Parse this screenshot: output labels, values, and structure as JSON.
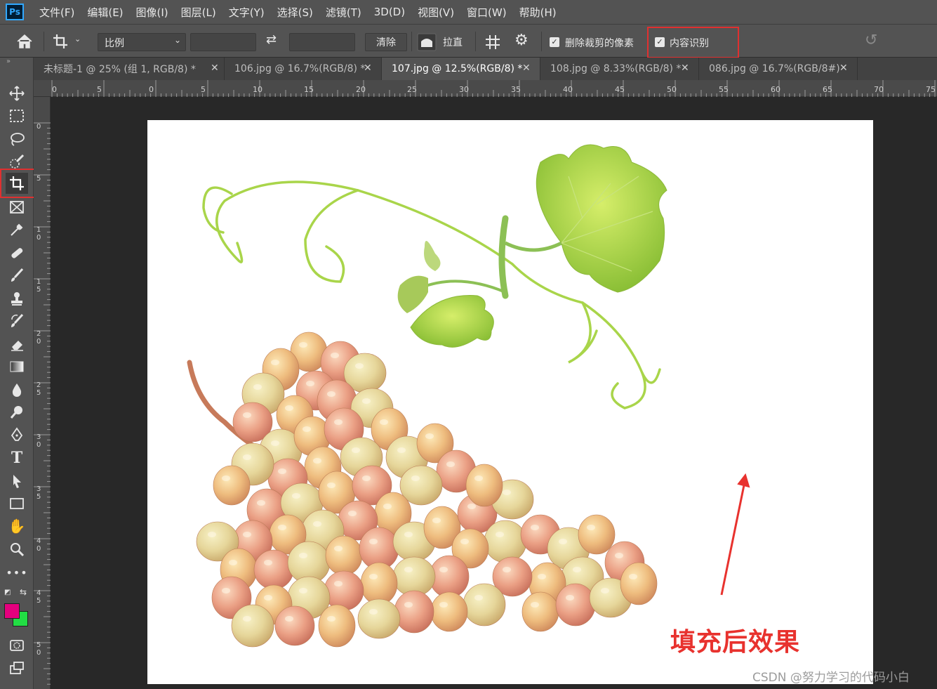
{
  "app": {
    "logo": "Ps"
  },
  "menu": [
    "文件(F)",
    "编辑(E)",
    "图像(I)",
    "图层(L)",
    "文字(Y)",
    "选择(S)",
    "滤镜(T)",
    "3D(D)",
    "视图(V)",
    "窗口(W)",
    "帮助(H)"
  ],
  "options": {
    "ratio_select": "比例",
    "clear_label": "清除",
    "straighten_label": "拉直",
    "delete_cropped_label": "删除裁剪的像素",
    "delete_cropped_checked": true,
    "content_aware_label": "内容识别",
    "content_aware_checked": true
  },
  "tabs": [
    {
      "title": "未标题-1 @ 25% (组 1, RGB/8) *",
      "active": false
    },
    {
      "title": "106.jpg @ 16.7%(RGB/8) *",
      "active": false
    },
    {
      "title": "107.jpg @ 12.5%(RGB/8) *",
      "active": true
    },
    {
      "title": "108.jpg @ 8.33%(RGB/8) *",
      "active": false
    },
    {
      "title": "086.jpg @ 16.7%(RGB/8#)",
      "active": false
    }
  ],
  "ruler": {
    "horizontal": [
      "0",
      "5",
      "0",
      "5",
      "10",
      "15",
      "20",
      "25",
      "30",
      "35",
      "40",
      "45",
      "50",
      "55",
      "60",
      "65",
      "70",
      "75"
    ],
    "vertical": [
      "0",
      "5",
      "1\n0",
      "1\n5",
      "2\n0",
      "2\n5",
      "3\n0",
      "3\n5",
      "4\n0",
      "4\n5",
      "5\n0"
    ]
  },
  "colors": {
    "foreground": "#e5007e",
    "background": "#22dd44",
    "highlight": "#e03030"
  },
  "annotation": {
    "caption": "填充后效果"
  },
  "watermark": "CSDN @努力学习的代码小白",
  "tools": [
    "move-tool-icon",
    "marquee-tool-icon",
    "lasso-tool-icon",
    "quick-select-tool-icon",
    "crop-tool-icon",
    "frame-tool-icon",
    "eyedropper-tool-icon",
    "healing-brush-tool-icon",
    "brush-tool-icon",
    "clone-stamp-tool-icon",
    "history-brush-tool-icon",
    "eraser-tool-icon",
    "gradient-tool-icon",
    "blur-tool-icon",
    "dodge-tool-icon",
    "pen-tool-icon",
    "type-tool-icon",
    "path-select-tool-icon",
    "rectangle-tool-icon",
    "hand-tool-icon",
    "zoom-tool-icon",
    "more-tools-icon"
  ]
}
